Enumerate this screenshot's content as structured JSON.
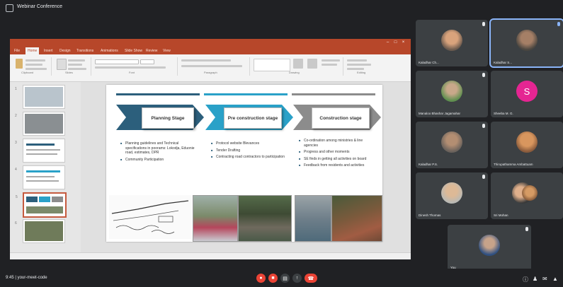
{
  "window": {
    "title": "Webinar Conference"
  },
  "ppt": {
    "document_title": "",
    "user_name": "",
    "menu_tabs": [
      "File",
      "Home",
      "Insert",
      "Design",
      "Transitions",
      "Animations",
      "Slide Show",
      "Review",
      "View"
    ],
    "ribbon_groups": [
      "Clipboard",
      "Slides",
      "Font",
      "Paragraph",
      "Drawing",
      "Editing"
    ],
    "slide_numbers": [
      "1",
      "2",
      "3",
      "4",
      "5",
      "6"
    ]
  },
  "slide": {
    "stages": [
      {
        "title": "Planning Stage",
        "color": "#2c5f7c",
        "bullets": [
          "Planning guidelines and Technical specifications in poorams: Lokodja, Eduonie road, estimates, DPR",
          "Community Participation"
        ]
      },
      {
        "title": "Pre construction stage",
        "color": "#2aa1c8",
        "bullets": [
          "Protocol website Blevances",
          "Tender Drafting",
          "Contracting road contractors to participation"
        ]
      },
      {
        "title": "Construction stage",
        "color": "#8c8c8c",
        "bullets": [
          "Co-ordination among ministries & line agencies",
          "Progress and other moments",
          "SE finds in getting all activities on board",
          "Feedback from residents and activities"
        ]
      }
    ]
  },
  "participants": [
    {
      "name": "Kaladhar Ch..."
    },
    {
      "name": "Kaladhar S..."
    },
    {
      "name": "Manaloo Bhashar Jagamahar"
    },
    {
      "name": "Sheeba M. G.",
      "initial": "S"
    },
    {
      "name": "Kaladhar P.S."
    },
    {
      "name": "Thirupathamma Ambattuam"
    },
    {
      "name": "Dinesh Thomas"
    },
    {
      "name": "Sri Mohan"
    },
    {
      "name": "You"
    }
  ],
  "bottom": {
    "time": "9:45",
    "meeting": "| your-meet-code"
  },
  "colors": {
    "accent": "#8ab4f8",
    "end_call": "#ea4335",
    "ppt_brand": "#b7472a"
  }
}
